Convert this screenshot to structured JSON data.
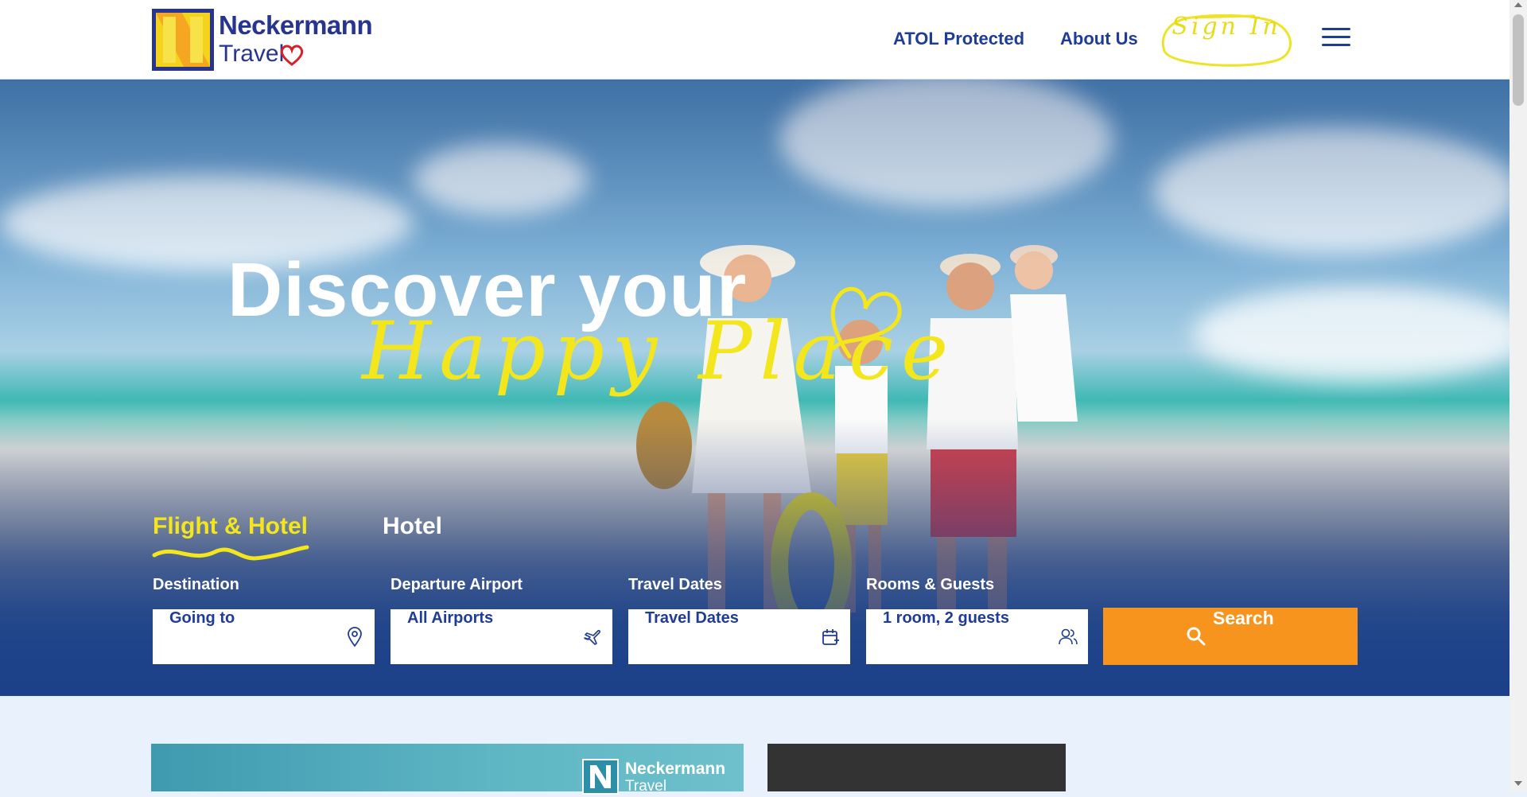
{
  "brand": {
    "name_line1": "Neckermann",
    "name_line2": "Travel"
  },
  "header": {
    "nav": [
      {
        "label": "ATOL Protected"
      },
      {
        "label": "About Us"
      }
    ],
    "sign_in_label": "Sign In"
  },
  "hero": {
    "headline": "Discover your",
    "script_line": "Happy Place"
  },
  "search": {
    "tabs": [
      {
        "label": "Flight & Hotel",
        "active": true
      },
      {
        "label": "Hotel",
        "active": false
      }
    ],
    "fields": [
      {
        "label": "Destination",
        "value": "Going to",
        "icon": "map-pin-icon"
      },
      {
        "label": "Departure Airport",
        "value": "All Airports",
        "icon": "plane-icon"
      },
      {
        "label": "Travel Dates",
        "value": "Travel Dates",
        "icon": "calendar-icon"
      },
      {
        "label": "Rooms & Guests",
        "value": "1 room, 2 guests",
        "icon": "guests-icon"
      }
    ],
    "button_label": "Search"
  },
  "promo": {
    "logo_line1": "Neckermann",
    "logo_line2": "Travel"
  },
  "colors": {
    "brand_blue": "#1f3c96",
    "accent_yellow": "#f3e61d",
    "search_orange": "#f7941d"
  }
}
